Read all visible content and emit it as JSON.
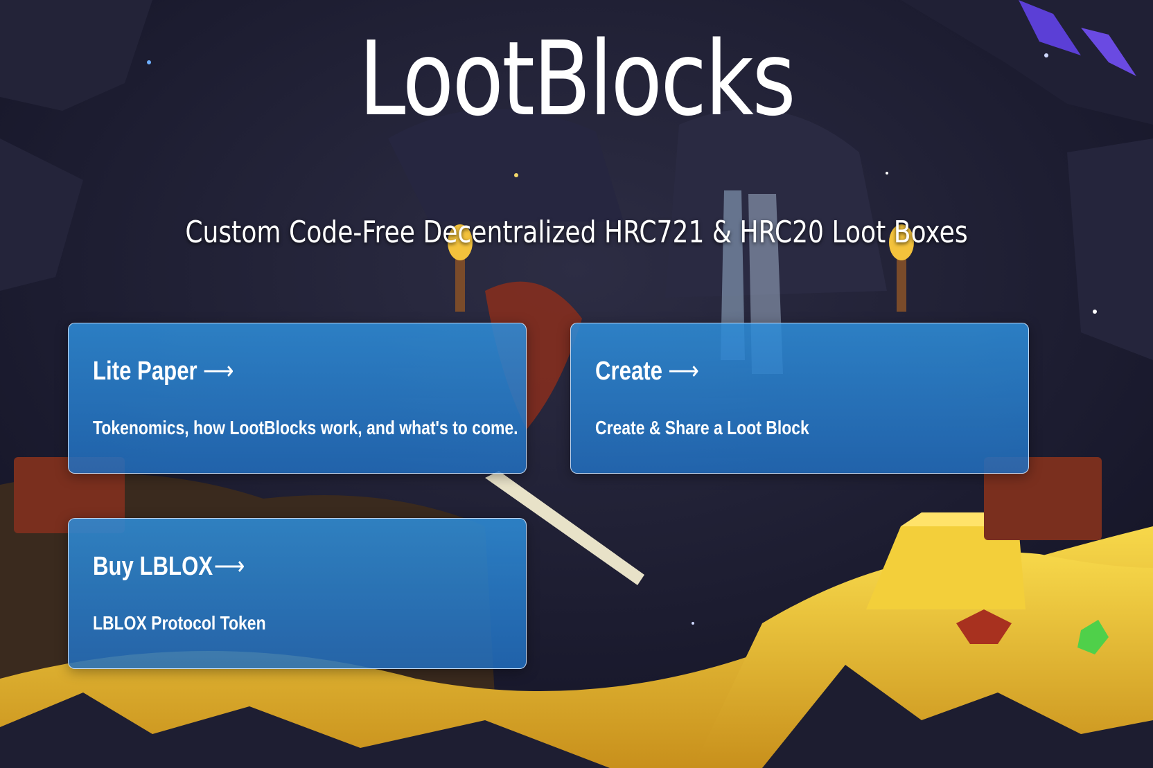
{
  "page": {
    "title": "LootBlocks",
    "subtitle": "Custom Code-Free Decentralized HRC721 & HRC20 Loot Boxes"
  },
  "cards": [
    {
      "heading": "Lite Paper",
      "arrow": "⟶",
      "description": "Tokenomics, how LootBlocks work, and what's to come."
    },
    {
      "heading": "Create",
      "arrow": "⟶",
      "description": "Create & Share a Loot Block"
    },
    {
      "heading": "Buy LBLOX",
      "arrow": "⟶",
      "description": "LBLOX Protocol Token"
    }
  ],
  "colors": {
    "card_fill": "#2b82cc",
    "card_border": "#dcebff",
    "background": "#1c1c2e",
    "gold": "#f0c430"
  },
  "icons": {
    "arrow": "right-arrow-icon"
  }
}
